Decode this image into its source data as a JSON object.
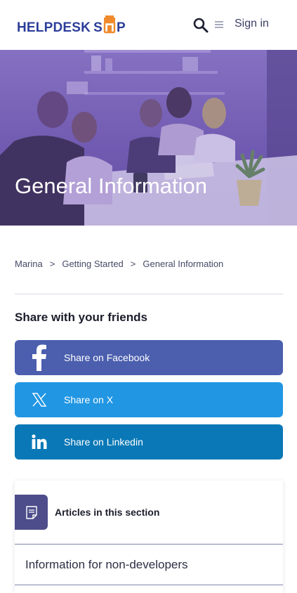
{
  "header": {
    "logo_part1": "HELPDESK",
    "logo_part2_prefix": "S",
    "logo_part2_suffix": "P",
    "signin": "Sign in"
  },
  "hero": {
    "title": "General Information"
  },
  "breadcrumb": [
    {
      "label": "Marina"
    },
    {
      "label": "Getting Started"
    },
    {
      "label": "General Information"
    }
  ],
  "share": {
    "title": "Share with your friends",
    "facebook": "Share on Facebook",
    "x": "Share on X",
    "linkedin": "Share on Linkedin"
  },
  "articles": {
    "title": "Articles in this section",
    "items": [
      "Information for non-developers"
    ]
  },
  "colors": {
    "brand": "#2c3e9a",
    "logo_orange": "#f08a2c",
    "facebook": "#4b5fae",
    "x": "#2196e3",
    "linkedin": "#0a78b6",
    "hero_overlay": "#7a64b8",
    "articles_icon_bg": "#4e4d8c"
  }
}
